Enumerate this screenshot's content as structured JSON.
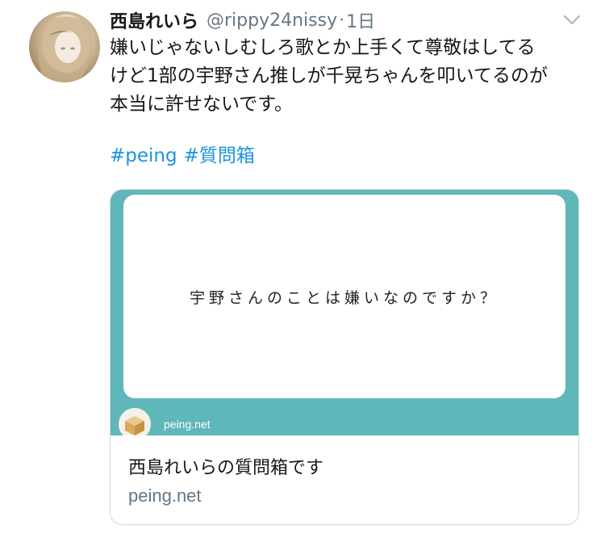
{
  "tweet": {
    "display_name": "西島れいら",
    "handle": "@rippy24nissy",
    "separator": "·",
    "timestamp": "1日",
    "text_lines": [
      "嫌いじゃないしむしろ歌とか上手くて尊敬はしてる",
      "けど1部の宇野さん推しが千晃ちゃんを叩いてるのが",
      "本当に許せないです。"
    ],
    "hashtags": [
      "#peing",
      "#質問箱"
    ],
    "avatar_icon": "user-avatar",
    "menu_icon": "chevron-down-icon"
  },
  "card": {
    "question": "宇野さんのことは嫌いなのですか？",
    "image_site_label": "peing.net",
    "title": "西島れいらの質問箱です",
    "domain": "peing.net",
    "accent_color": "#5fb7b9"
  },
  "colors": {
    "text": "#14171a",
    "secondary": "#657786",
    "link": "#1b95e0",
    "border": "#ccd6dd"
  }
}
